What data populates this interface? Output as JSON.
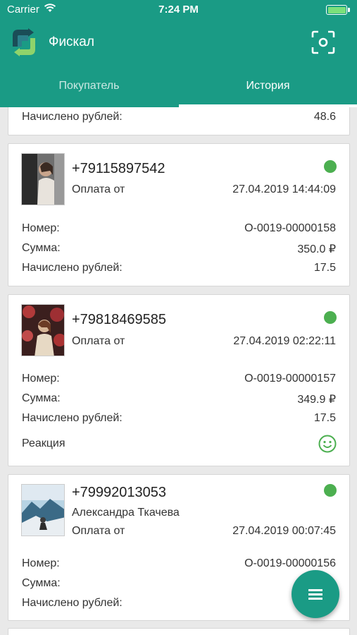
{
  "status_bar": {
    "carrier": "Carrier",
    "time": "7:24 PM"
  },
  "app": {
    "title": "Фискал"
  },
  "tabs": [
    {
      "label": "Покупатель",
      "active": false
    },
    {
      "label": "История",
      "active": true
    }
  ],
  "colors": {
    "primary": "#1a9b85",
    "status_dot": "#4caf50",
    "smile": "#4caf50"
  },
  "partial_card": {
    "accrued_label": "Начислено рублей:",
    "accrued_value": "48.6"
  },
  "transactions": [
    {
      "phone": "+79115897542",
      "name": "",
      "payment_label": "Оплата от",
      "datetime": "27.04.2019 14:44:09",
      "number_label": "Номер:",
      "number": "О-0019-00000158",
      "sum_label": "Сумма:",
      "sum": "350.0 ₽",
      "accrued_label": "Начислено рублей:",
      "accrued": "17.5"
    },
    {
      "phone": "+79818469585",
      "name": "",
      "payment_label": "Оплата от",
      "datetime": "27.04.2019 02:22:11",
      "number_label": "Номер:",
      "number": "О-0019-00000157",
      "sum_label": "Сумма:",
      "sum": "349.9 ₽",
      "accrued_label": "Начислено рублей:",
      "accrued": "17.5",
      "reaction_label": "Реакция",
      "reaction_icon": "smile-icon"
    },
    {
      "phone": "+79992013053",
      "name": "Александра Ткачева",
      "payment_label": "Оплата от",
      "datetime": "27.04.2019 00:07:45",
      "number_label": "Номер:",
      "number": "О-0019-00000156",
      "sum_label": "Сумма:",
      "sum": "",
      "accrued_label": "Начислено рублей:",
      "accrued": ""
    }
  ],
  "fab": {
    "icon": "menu-icon"
  }
}
